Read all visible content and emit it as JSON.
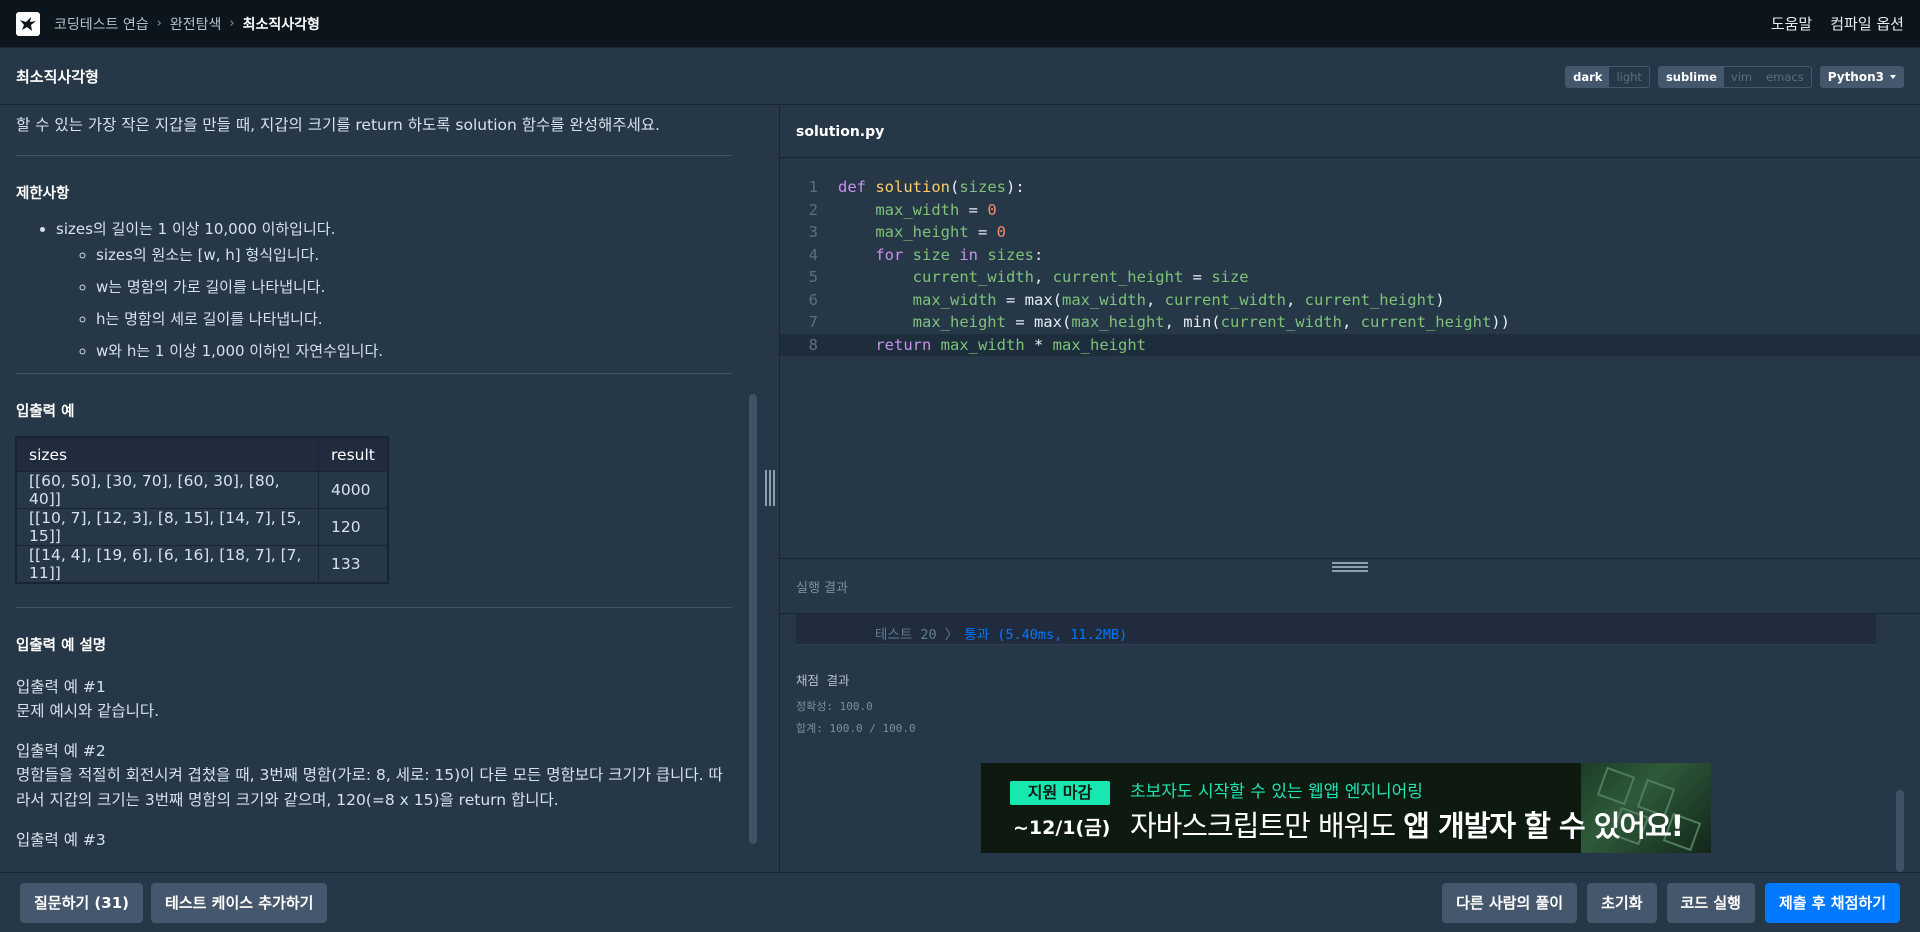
{
  "nav": {
    "breadcrumbs": [
      "코딩테스트 연습",
      "완전탐색",
      "최소직사각형"
    ],
    "right_links": [
      "도움말",
      "컴파일 옵션"
    ]
  },
  "titlebar": {
    "title": "최소직사각형",
    "theme_options": [
      "dark",
      "light"
    ],
    "theme_selected": "dark",
    "keymap_options": [
      "sublime",
      "vim",
      "emacs"
    ],
    "keymap_selected": "sublime",
    "language": "Python3"
  },
  "problem": {
    "intro": "할 수 있는 가장 작은 지갑을 만들 때, 지갑의 크기를 return 하도록 solution 함수를 완성해주세요.",
    "constraints_title": "제한사항",
    "constraint_main": "sizes의 길이는 1 이상 10,000 이하입니다.",
    "constraint_subs": [
      "sizes의 원소는 [w, h] 형식입니다.",
      "w는 명함의 가로 길이를 나타냅니다.",
      "h는 명함의 세로 길이를 나타냅니다.",
      "w와 h는 1 이상 1,000 이하인 자연수입니다."
    ],
    "io_title": "입출력 예",
    "table_headers": [
      "sizes",
      "result"
    ],
    "table_rows": [
      [
        "[[60, 50], [30, 70], [60, 30], [80, 40]]",
        "4000"
      ],
      [
        "[[10, 7], [12, 3], [8, 15], [14, 7], [5, 15]]",
        "120"
      ],
      [
        "[[14, 4], [19, 6], [6, 16], [18, 7], [7, 11]]",
        "133"
      ]
    ],
    "explain_title": "입출력 예 설명",
    "ex1_head": "입출력 예 #1",
    "ex1_body": "문제 예시와 같습니다.",
    "ex2_head": "입출력 예 #2",
    "ex2_body": "명함들을 적절히 회전시켜 겹쳤을 때, 3번째 명함(가로: 8, 세로: 15)이 다른 모든 명함보다 크기가 큽니다. 따라서 지갑의 크기는 3번째 명함의 크기와 같으며, 120(=8 x 15)을 return 합니다.",
    "ex3_head": "입출력 예 #3"
  },
  "editor": {
    "filename": "solution.py",
    "line_numbers": [
      "1",
      "2",
      "3",
      "4",
      "5",
      "6",
      "7",
      "8"
    ],
    "active_line": 8,
    "code_lines": [
      "def solution(sizes):",
      "    max_width = 0",
      "    max_height = 0",
      "    for size in sizes:",
      "        current_width, current_height = size",
      "        max_width = max(max_width, current_width, current_height)",
      "        max_height = max(max_height, min(current_width, current_height))",
      "    return max_width * max_height"
    ]
  },
  "result": {
    "title": "실행 결과",
    "test_label": "테스트 20 〉",
    "test_status": "통과 (5.40ms, 11.2MB)",
    "grade_title": "채점 결과",
    "accuracy": "정확성: 100.0",
    "total": "합계: 100.0 / 100.0"
  },
  "ad": {
    "badge": "지원 마감",
    "date": "~12/1(금)",
    "line1": "초보자도 시작할 수 있는 웹앱 엔지니어링",
    "line2_normal": "자바스크립트만 배워도 ",
    "line2_bold": "앱 개발자 할 수 있어요!"
  },
  "bottom": {
    "ask": "질문하기 (31)",
    "add_test": "테스트 케이스 추가하기",
    "others": "다른 사람의 풀이",
    "reset": "초기화",
    "run": "코드 실행",
    "submit": "제출 후 채점하기"
  },
  "colors": {
    "background": "#263747",
    "nav": "#0c151c",
    "primary": "#0078ff",
    "keyword": "#c792ea",
    "function": "#ffcb6b",
    "variable": "#7ec27a",
    "number": "#f78c6c",
    "ad_accent": "#17e8b0"
  }
}
